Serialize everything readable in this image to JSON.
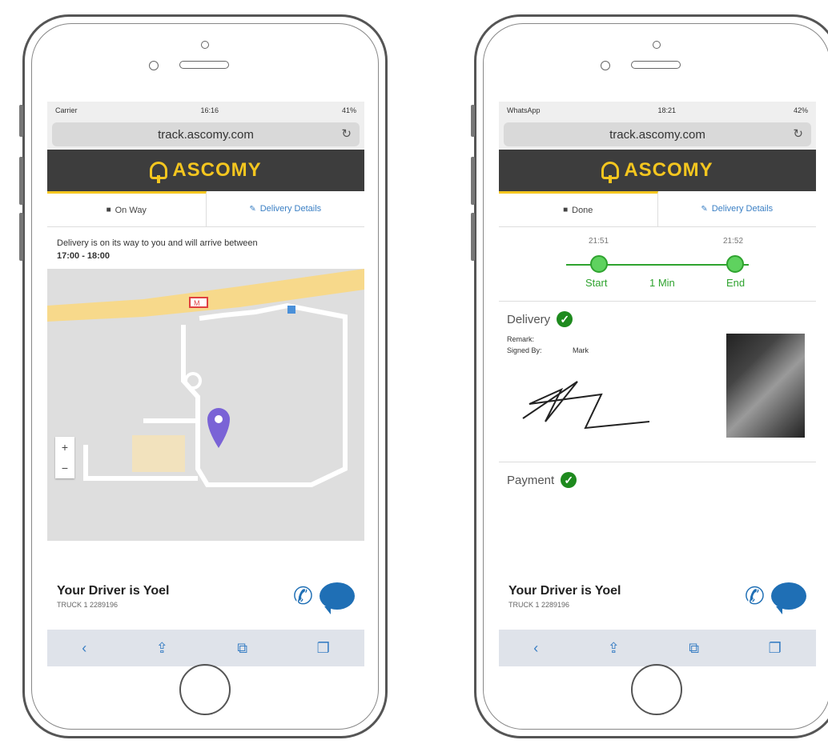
{
  "left": {
    "status": {
      "carrier": "Carrier",
      "time": "16:16",
      "battery": "41%"
    },
    "url": "track.ascomy.com",
    "brand": "ASCOMY",
    "tabs": {
      "active": "On Way",
      "other": "Delivery Details"
    },
    "message": "Delivery is on its way to you and will arrive between",
    "window": "17:00 - 18:00",
    "map": {
      "zoom_in": "+",
      "zoom_out": "−",
      "road_label": "M"
    },
    "driver": {
      "name": "Your Driver is Yoel",
      "truck": "TRUCK 1 2289196"
    }
  },
  "right": {
    "status": {
      "carrier": "WhatsApp",
      "time": "18:21",
      "battery": "42%"
    },
    "url": "track.ascomy.com",
    "brand": "ASCOMY",
    "tabs": {
      "active": "Done",
      "other": "Delivery Details"
    },
    "timeline": {
      "start_time": "21:51",
      "end_time": "21:52",
      "start_label": "Start",
      "end_label": "End",
      "duration": "1 Min"
    },
    "delivery": {
      "title": "Delivery",
      "remark_label": "Remark:",
      "signed_label": "Signed By:",
      "signed_value": "Mark"
    },
    "payment": {
      "title": "Payment"
    },
    "driver": {
      "name": "Your Driver is Yoel",
      "truck": "TRUCK 1 2289196"
    }
  },
  "toolbar": {
    "back": "‹",
    "share": "⇪",
    "books": "⧉",
    "tabs": "❐"
  },
  "colors": {
    "brand_yellow": "#f4c61f",
    "header_dark": "#3d3d3d",
    "link_blue": "#3a7fc4",
    "success_green": "#2fa32f",
    "map_road": "#f7d98b"
  }
}
